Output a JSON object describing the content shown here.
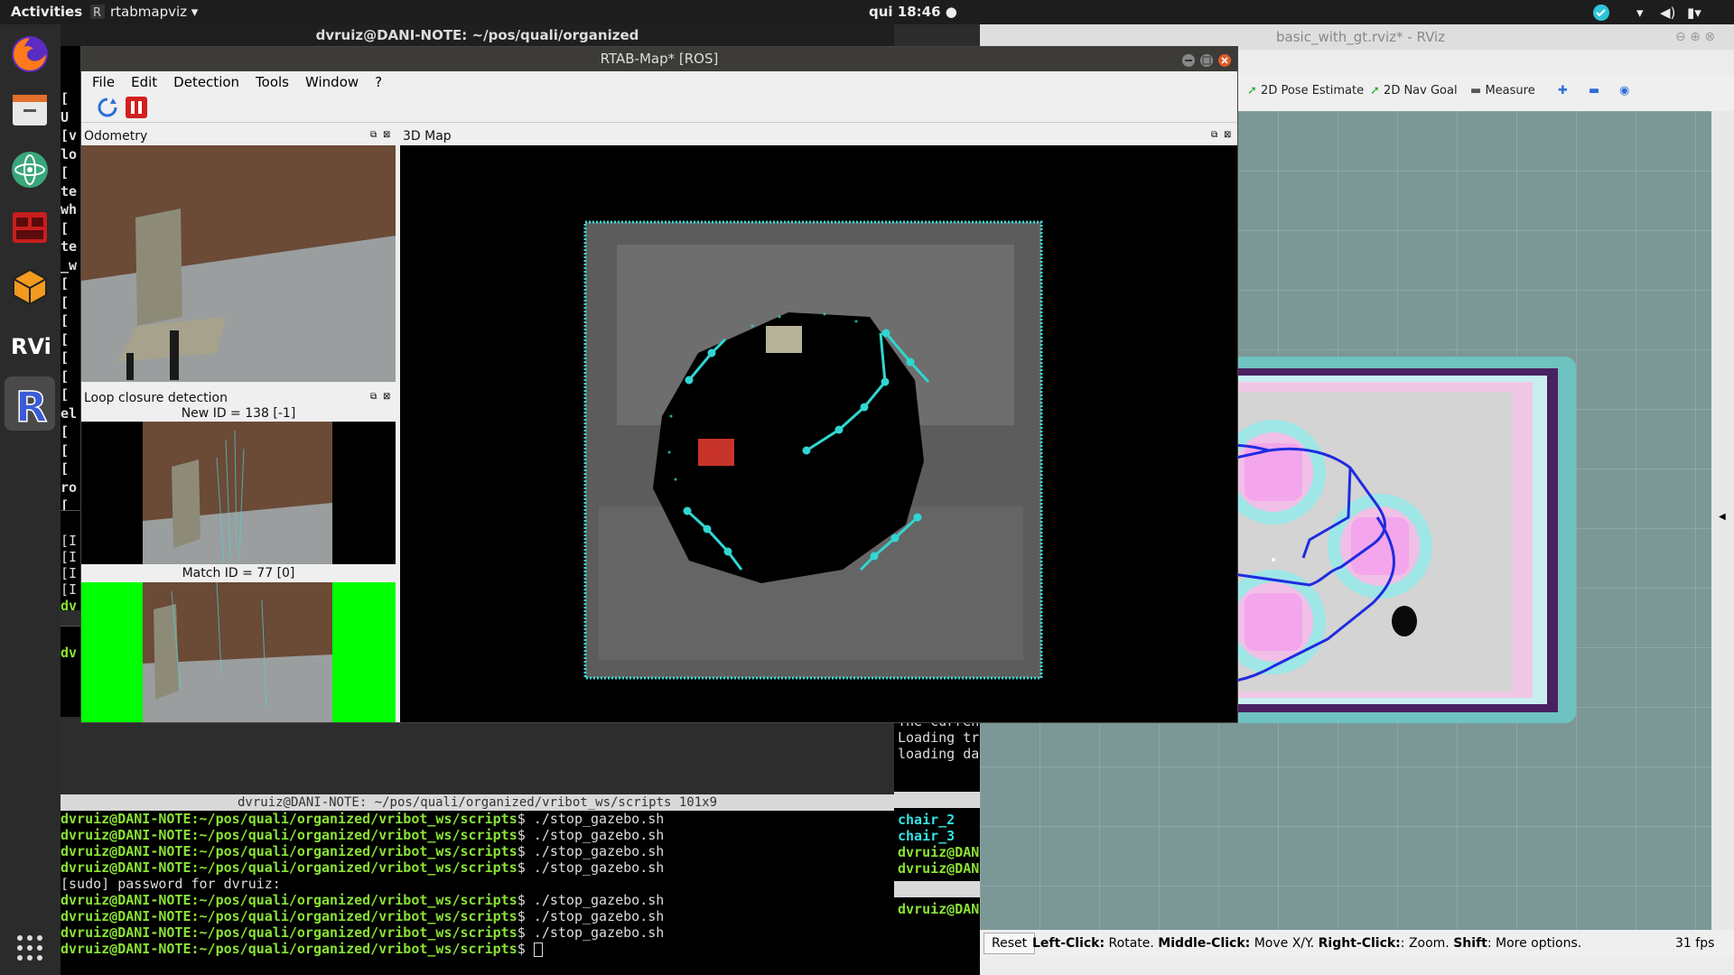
{
  "topbar": {
    "activities": "Activities",
    "app_name": "rtabmapviz ▾",
    "clock": "qui 18:46 ●"
  },
  "left_terminal": {
    "title": "dvruiz@DANI-NOTE: ~/pos/quali/organized",
    "lines": [
      "[",
      "U",
      "[v",
      "lo",
      "[",
      "te",
      "wh",
      "[",
      "te",
      "_w",
      "[",
      "[",
      "[",
      "[",
      "[",
      "[",
      "[",
      "el",
      "[",
      "[",
      "[",
      "ro",
      "[",
      "[]"
    ],
    "lines2": [
      "[I",
      "[I",
      "[I",
      "[I",
      "dv"
    ],
    "lines3": [
      "dv"
    ]
  },
  "rtabmap": {
    "title": "RTAB-Map* [ROS]",
    "menu": [
      "File",
      "Edit",
      "Detection",
      "Tools",
      "Window",
      "?"
    ],
    "odometry_title": "Odometry",
    "loop_title": "Loop closure detection",
    "new_id": "New ID = 138 [-1]",
    "match_id": "Match ID = 77 [0]",
    "map_title": "3D Map"
  },
  "bottom_terminal": {
    "title": "dvruiz@DANI-NOTE: ~/pos/quali/organized/vribot_ws/scripts 101x9",
    "prompt": "dvruiz@DANI-NOTE:~/pos/quali/organized/vribot_ws/scripts",
    "rows": [
      {
        "cmd": "$ ./stop_gazebo.sh"
      },
      {
        "cmd": "$ ./stop_gazebo.sh"
      },
      {
        "cmd": "$ ./stop_gazebo.sh"
      },
      {
        "cmd": "$ ./stop_gazebo.sh"
      },
      {
        "plain": "[sudo] password for dvruiz:"
      },
      {
        "cmd": "$ ./stop_gazebo.sh"
      },
      {
        "cmd": "$ ./stop_gazebo.sh"
      },
      {
        "cmd": "$ ./stop_gazebo.sh"
      },
      {
        "cmd": "$ "
      }
    ]
  },
  "mid_terminal": {
    "lines": [
      "The curren",
      "Loading tr",
      "loading da"
    ],
    "lines2": [
      "chair_2",
      "chair_3",
      "dvruiz@DAN",
      "dvruiz@DAN"
    ],
    "lines3": [
      "dvruiz@DAN"
    ]
  },
  "rviz": {
    "title": "basic_with_gt.rviz* - RViz",
    "tools": [
      "2D Pose Estimate",
      "2D Nav Goal",
      "Measure"
    ],
    "reset": "Reset",
    "hint_b1": "Left-Click:",
    "hint_t1": " Rotate. ",
    "hint_b2": "Middle-Click:",
    "hint_t2": " Move X/Y. ",
    "hint_b3": "Right-Click:",
    "hint_t3": ": Zoom. ",
    "hint_b4": "Shift",
    "hint_t4": ": More options.",
    "fps": "31 fps"
  }
}
